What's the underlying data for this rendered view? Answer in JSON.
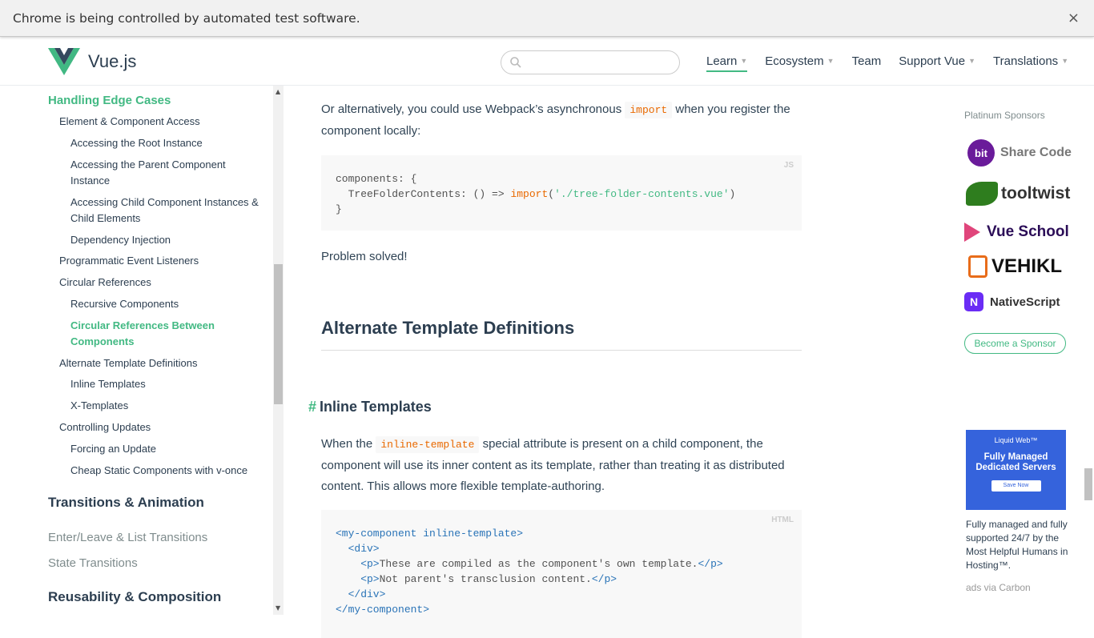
{
  "infobar": {
    "message": "Chrome is being controlled by automated test software.",
    "close": "×"
  },
  "header": {
    "logo": "Vue.js",
    "search_placeholder": "",
    "nav": [
      {
        "label": "Learn",
        "caret": true
      },
      {
        "label": "Ecosystem",
        "caret": true
      },
      {
        "label": "Team",
        "caret": false
      },
      {
        "label": "Support Vue",
        "caret": true
      },
      {
        "label": "Translations",
        "caret": true
      }
    ]
  },
  "sidebar": {
    "heading": "Handling Edge Cases",
    "items": [
      "Element & Component Access",
      "Accessing the Root Instance",
      "Accessing the Parent Component Instance",
      "Accessing Child Component Instances & Child Elements",
      "Dependency Injection",
      "Programmatic Event Listeners",
      "Circular References",
      "Recursive Components",
      "Circular References Between Components",
      "Alternate Template Definitions",
      "Inline Templates",
      "X-Templates",
      "Controlling Updates",
      "Forcing an Update",
      "Cheap Static Components with v-once"
    ],
    "section1": "Transitions & Animation",
    "sub1": [
      "Enter/Leave & List Transitions",
      "State Transitions"
    ],
    "section2": "Reusability & Composition"
  },
  "main": {
    "p1a": "Or alternatively, you could use Webpack’s asynchronous ",
    "p1code": "import",
    "p1b": " when you register the component locally:",
    "code1": {
      "lang": "JS",
      "l1": "components: {",
      "l2a": "  TreeFolderContents: () => ",
      "l2b": "import",
      "l2c": "(",
      "l2d": "'./tree-folder-contents.vue'",
      "l2e": ")",
      "l3": "}"
    },
    "p2": "Problem solved!",
    "h2": "Alternate Template Definitions",
    "h3hash": "#",
    "h3": "Inline Templates",
    "p3a": "When the ",
    "p3code": "inline-template",
    "p3b": " special attribute is present on a child component, the component will use its inner content as its template, rather than treating it as distributed content. This allows more flexible template-authoring.",
    "code2": {
      "lang": "HTML",
      "l1": "<my-component inline-template>",
      "l2": "  <div>",
      "l3a": "    <p>",
      "l3b": "These are compiled as the component's own template.",
      "l3c": "</p>",
      "l4a": "    <p>",
      "l4b": "Not parent's transclusion content.",
      "l4c": "</p>",
      "l5": "  </div>",
      "l6": "</my-component>"
    }
  },
  "right": {
    "sponsors_title": "Platinum Sponsors",
    "sponsors": [
      "Share Code",
      "tooltwist",
      "Vue School",
      "VEHIKL",
      "NativeScript"
    ],
    "bit": "bit",
    "become": "Become a Sponsor",
    "ad": {
      "brand": "Liquid Web™",
      "headline": "Fully Managed Dedicated Servers",
      "cta": "Save Now",
      "text": "Fully managed and fully supported 24/7 by the Most Helpful Humans in Hosting™.",
      "via": "ads via Carbon"
    }
  },
  "colors": {
    "accent": "#42b983",
    "code_orange": "#e96900",
    "tag_blue": "#2973b7"
  }
}
